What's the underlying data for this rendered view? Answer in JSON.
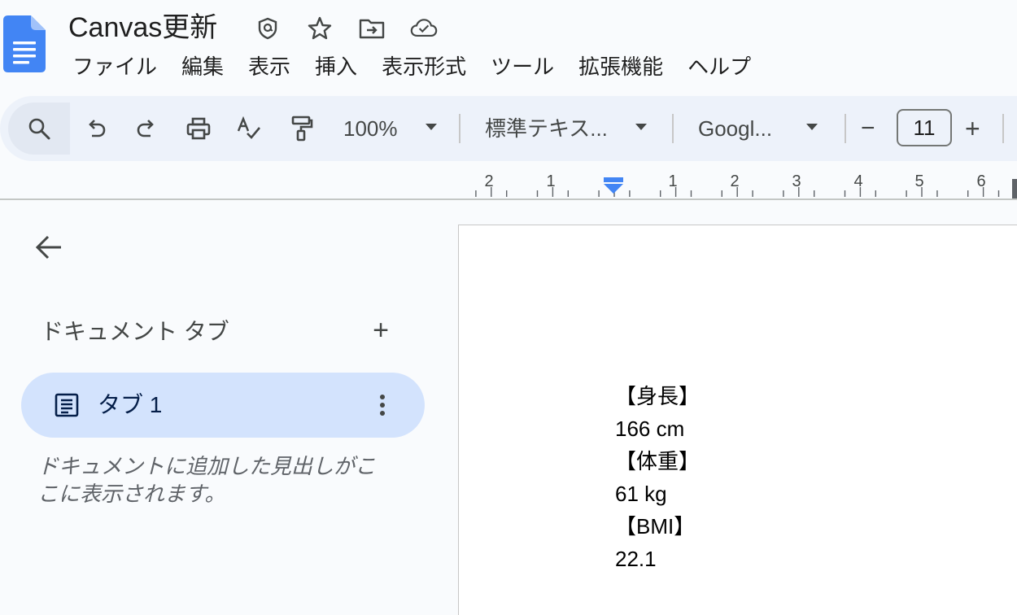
{
  "doc": {
    "title": "Canvas更新",
    "icons": [
      "move-to-folder-icon",
      "star-icon",
      "folder-icon",
      "cloud-saved-icon"
    ]
  },
  "menu": [
    "ファイル",
    "編集",
    "表示",
    "挿入",
    "表示形式",
    "ツール",
    "拡張機能",
    "ヘルプ"
  ],
  "toolbar": {
    "zoom": "100%",
    "style": "標準テキス...",
    "font": "Googl...",
    "font_size": "11",
    "decrease_label": "−",
    "increase_label": "+"
  },
  "ruler": {
    "labels": [
      "2",
      "1",
      "1",
      "2",
      "3",
      "4",
      "5",
      "6"
    ]
  },
  "sidebar": {
    "heading": "ドキュメント タブ",
    "add_label": "+",
    "tab_label": "タブ 1",
    "note": "ドキュメントに追加した見出しがここに表示されます。"
  },
  "document": {
    "lines": [
      "【身長】",
      "166 cm",
      "【体重】",
      "61 kg",
      "【BMI】",
      "22.1"
    ]
  },
  "colors": {
    "accent": "#4285f4",
    "selected_tab": "#d3e3fd",
    "toolbar_bg": "#edf2fa"
  }
}
